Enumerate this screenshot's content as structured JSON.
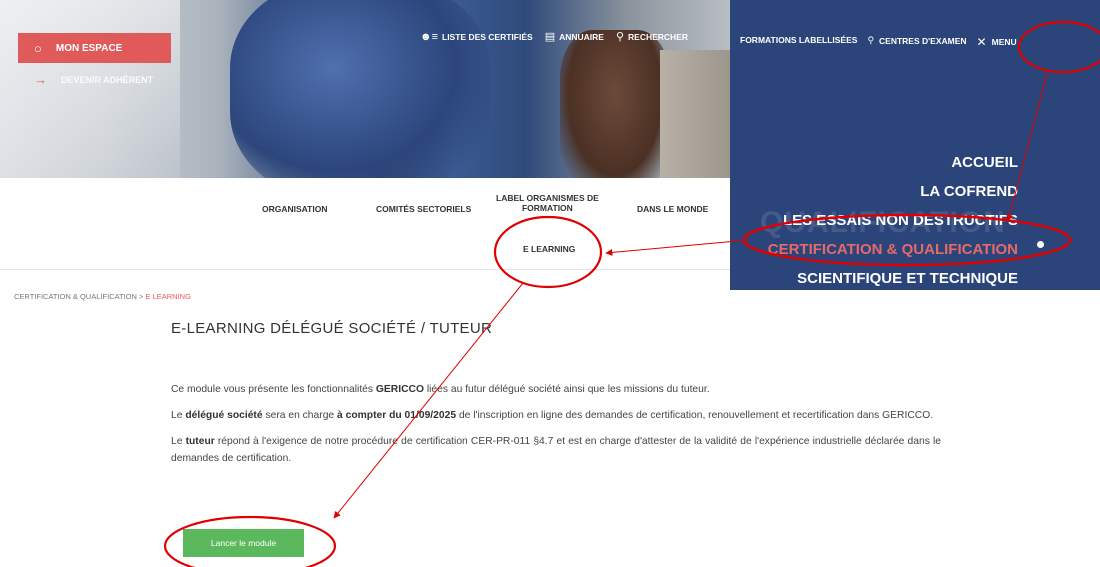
{
  "hero": {
    "account_button": "MON ESPACE",
    "member_link": "DEVENIR ADHÉRENT",
    "top_links": [
      {
        "icon": "certified-list-icon",
        "label": "LISTE DES CERTIFIÉS"
      },
      {
        "icon": "book-icon",
        "label": "ANNUAIRE"
      },
      {
        "icon": "search-icon",
        "label": "RECHERCHER"
      }
    ]
  },
  "menu_panel": {
    "formations": "FORMATIONS LABELLISÉES",
    "centres": "CENTRES D'EXAMEN",
    "menu_label": "MENU",
    "items": [
      {
        "label": "ACCUEIL",
        "active": false
      },
      {
        "label": "LA COFREND",
        "active": false
      },
      {
        "label": "LES ESSAIS NON DESTRUCTIFS",
        "active": false
      },
      {
        "label": "CERTIFICATION & QUALIFICATION",
        "active": true
      },
      {
        "label": "SCIENTIFIQUE ET TECHNIQUE",
        "active": false
      }
    ],
    "ghost_text": "QUALIFICATION"
  },
  "subnav": {
    "organisation": "ORGANISATION",
    "comites": "COMITÉS SECTORIELS",
    "label_l1": "LABEL ORGANISMES DE",
    "label_l2": "FORMATION",
    "monde": "DANS LE MONDE",
    "elearning": "E LEARNING"
  },
  "breadcrumb": {
    "parent": "CERTIFICATION & QUALIFICATION",
    "separator": " > ",
    "current": "E LEARNING"
  },
  "page": {
    "title": "E-LEARNING DÉLÉGUÉ SOCIÉTÉ / TUTEUR",
    "p1_a": "Ce module vous présente les fonctionnalités ",
    "p1_b": "GERICCO",
    "p1_c": " liées au futur délégué société ainsi que les missions du tuteur.",
    "p2_a": "Le ",
    "p2_b": "délégué société",
    "p2_c": " sera en charge ",
    "p2_d": "à compter du 01/09/2025",
    "p2_e": " de l'inscription en ligne des demandes de certification, renouvellement et recertification dans GERICCO.",
    "p3_a": "Le ",
    "p3_b": "tuteur",
    "p3_c": " répond à l'exigence de notre procédure de certification CER-PR-011 §4.7 et est en charge d'attester de la validité de l'expérience industrielle déclarée dans le demandes de certification.",
    "button": "Lancer le module"
  },
  "colors": {
    "accent_red": "#e05a5a",
    "menu_blue": "#2b447a",
    "button_green": "#5cb85c",
    "annotation_red": "#e00000"
  }
}
